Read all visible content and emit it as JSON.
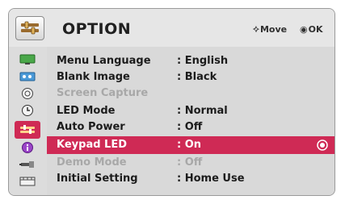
{
  "header": {
    "title": "OPTION",
    "icon": "option-icon",
    "hints": {
      "move": "Move",
      "ok": "OK",
      "move_icon": "dpad-icon",
      "ok_icon": "ok-button-icon"
    }
  },
  "sidebar": {
    "items": [
      {
        "name": "picture",
        "icon": "monitor-icon",
        "color": "#3a9a3a"
      },
      {
        "name": "audio",
        "icon": "speaker-icon",
        "color": "#3c88c8"
      },
      {
        "name": "settings",
        "icon": "disc-icon",
        "color": "#777777"
      },
      {
        "name": "time",
        "icon": "clock-icon",
        "color": "#555555"
      },
      {
        "name": "option",
        "icon": "option-icon",
        "color": "#d03a5c",
        "active": true
      },
      {
        "name": "info",
        "icon": "info-icon",
        "color": "#8a3ab8"
      },
      {
        "name": "input",
        "icon": "input-icon",
        "color": "#555555"
      },
      {
        "name": "media",
        "icon": "media-icon",
        "color": "#555555"
      }
    ]
  },
  "menu": {
    "items": [
      {
        "label": "Menu Language",
        "value": ": English",
        "state": "normal"
      },
      {
        "label": "Blank Image",
        "value": ": Black",
        "state": "normal"
      },
      {
        "label": "Screen Capture",
        "value": "",
        "state": "disabled"
      },
      {
        "label": "LED Mode",
        "value": ": Normal",
        "state": "normal"
      },
      {
        "label": "Auto Power",
        "value": ": Off",
        "state": "normal"
      },
      {
        "label": "Keypad LED",
        "value": ": On",
        "state": "selected"
      },
      {
        "label": "Demo Mode",
        "value": ": Off",
        "state": "disabled"
      },
      {
        "label": "Initial Setting",
        "value": ": Home Use",
        "state": "normal"
      }
    ]
  },
  "colors": {
    "accent": "#cf2a55",
    "disabled": "#a8a8a8",
    "text": "#1c1c1c"
  }
}
